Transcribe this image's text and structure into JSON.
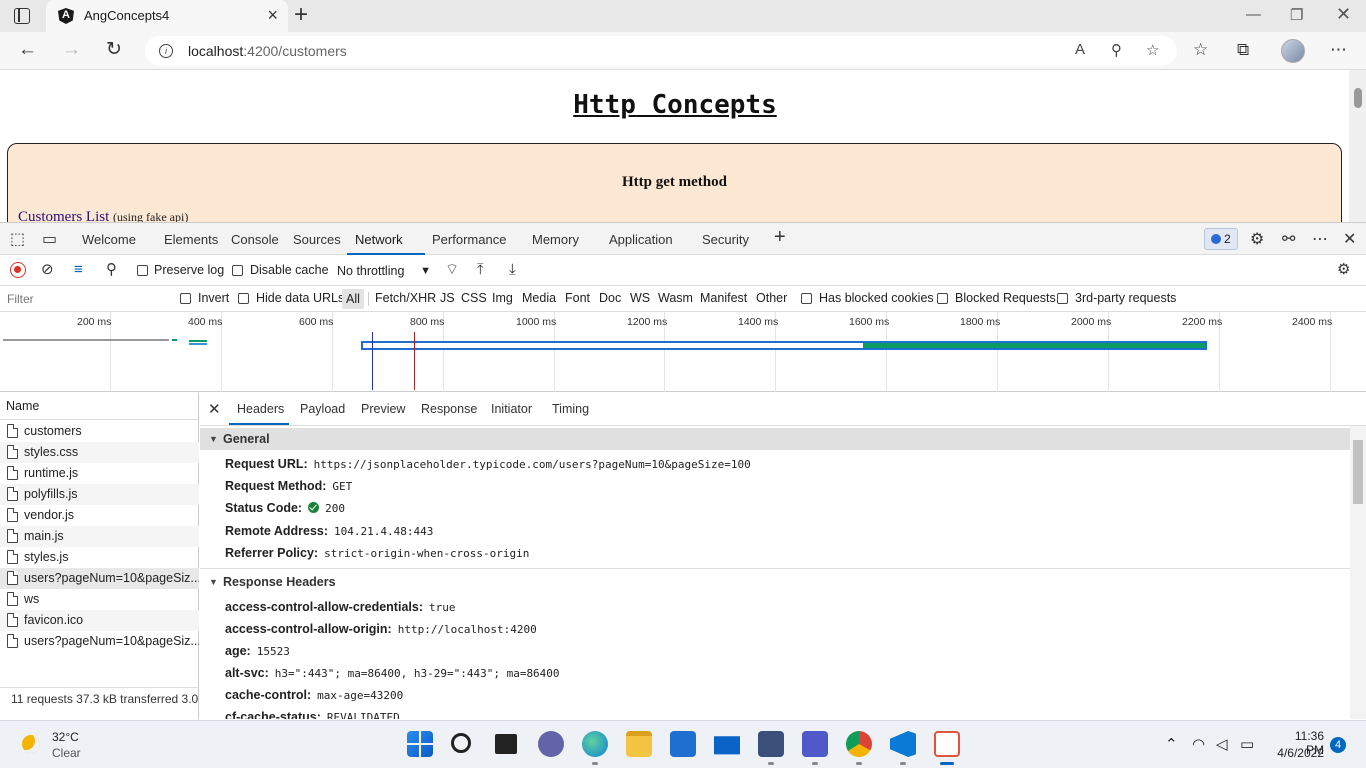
{
  "browser": {
    "tab_title": "AngConcepts4",
    "url_host": "localhost",
    "url_path": ":4200/customers"
  },
  "page": {
    "title": "Http Concepts",
    "card_heading": "Http get method",
    "customers_link": "Customers List",
    "customers_note": "(using fake api)"
  },
  "devtools": {
    "tabs": [
      "Welcome",
      "Elements",
      "Console",
      "Sources",
      "Network",
      "Performance",
      "Memory",
      "Application",
      "Security"
    ],
    "active_tab": "Network",
    "issues_count": "2",
    "toolbar": {
      "preserve_log": "Preserve log",
      "disable_cache": "Disable cache",
      "throttling": "No throttling"
    },
    "filter": {
      "placeholder": "Filter",
      "invert": "Invert",
      "hide_data_urls": "Hide data URLs",
      "types": [
        "All",
        "Fetch/XHR",
        "JS",
        "CSS",
        "Img",
        "Media",
        "Font",
        "Doc",
        "WS",
        "Wasm",
        "Manifest",
        "Other"
      ],
      "has_blocked_cookies": "Has blocked cookies",
      "blocked_requests": "Blocked Requests",
      "third_party": "3rd-party requests"
    },
    "overview_ticks": [
      "200 ms",
      "400 ms",
      "600 ms",
      "800 ms",
      "1000 ms",
      "1200 ms",
      "1400 ms",
      "1600 ms",
      "1800 ms",
      "2000 ms",
      "2200 ms",
      "2400 ms"
    ],
    "requests_header": "Name",
    "requests": [
      "customers",
      "styles.css",
      "runtime.js",
      "polyfills.js",
      "vendor.js",
      "main.js",
      "styles.js",
      "users?pageNum=10&pageSiz...",
      "ws",
      "favicon.ico",
      "users?pageNum=10&pageSiz..."
    ],
    "selected_request_index": 7,
    "requests_summary": "11 requests   37.3 kB transferred   3.0",
    "detail_tabs": [
      "Headers",
      "Payload",
      "Preview",
      "Response",
      "Initiator",
      "Timing"
    ],
    "active_detail_tab": "Headers",
    "general": {
      "title": "General",
      "request_url_label": "Request URL:",
      "request_url": "https://jsonplaceholder.typicode.com/users?pageNum=10&pageSize=100",
      "request_method_label": "Request Method:",
      "request_method": "GET",
      "status_code_label": "Status Code:",
      "status_code": "200",
      "remote_address_label": "Remote Address:",
      "remote_address": "104.21.4.48:443",
      "referrer_policy_label": "Referrer Policy:",
      "referrer_policy": "strict-origin-when-cross-origin"
    },
    "response_headers": {
      "title": "Response Headers",
      "items": [
        {
          "k": "access-control-allow-credentials:",
          "v": "true"
        },
        {
          "k": "access-control-allow-origin:",
          "v": "http://localhost:4200"
        },
        {
          "k": "age:",
          "v": "15523"
        },
        {
          "k": "alt-svc:",
          "v": "h3=\":443\"; ma=86400, h3-29=\":443\"; ma=86400"
        },
        {
          "k": "cache-control:",
          "v": "max-age=43200"
        },
        {
          "k": "cf-cache-status:",
          "v": "REVALIDATED"
        }
      ]
    }
  },
  "taskbar": {
    "weather_temp": "32°C",
    "weather_desc": "Clear",
    "time": "11:36 PM",
    "date": "4/6/2022",
    "notifications": "4"
  },
  "colors": {
    "accent": "#0067c0",
    "card_bg": "#fde8d3",
    "record": "#d93025",
    "status_ok": "#188038",
    "timeline_bar": "#0a9a64"
  }
}
